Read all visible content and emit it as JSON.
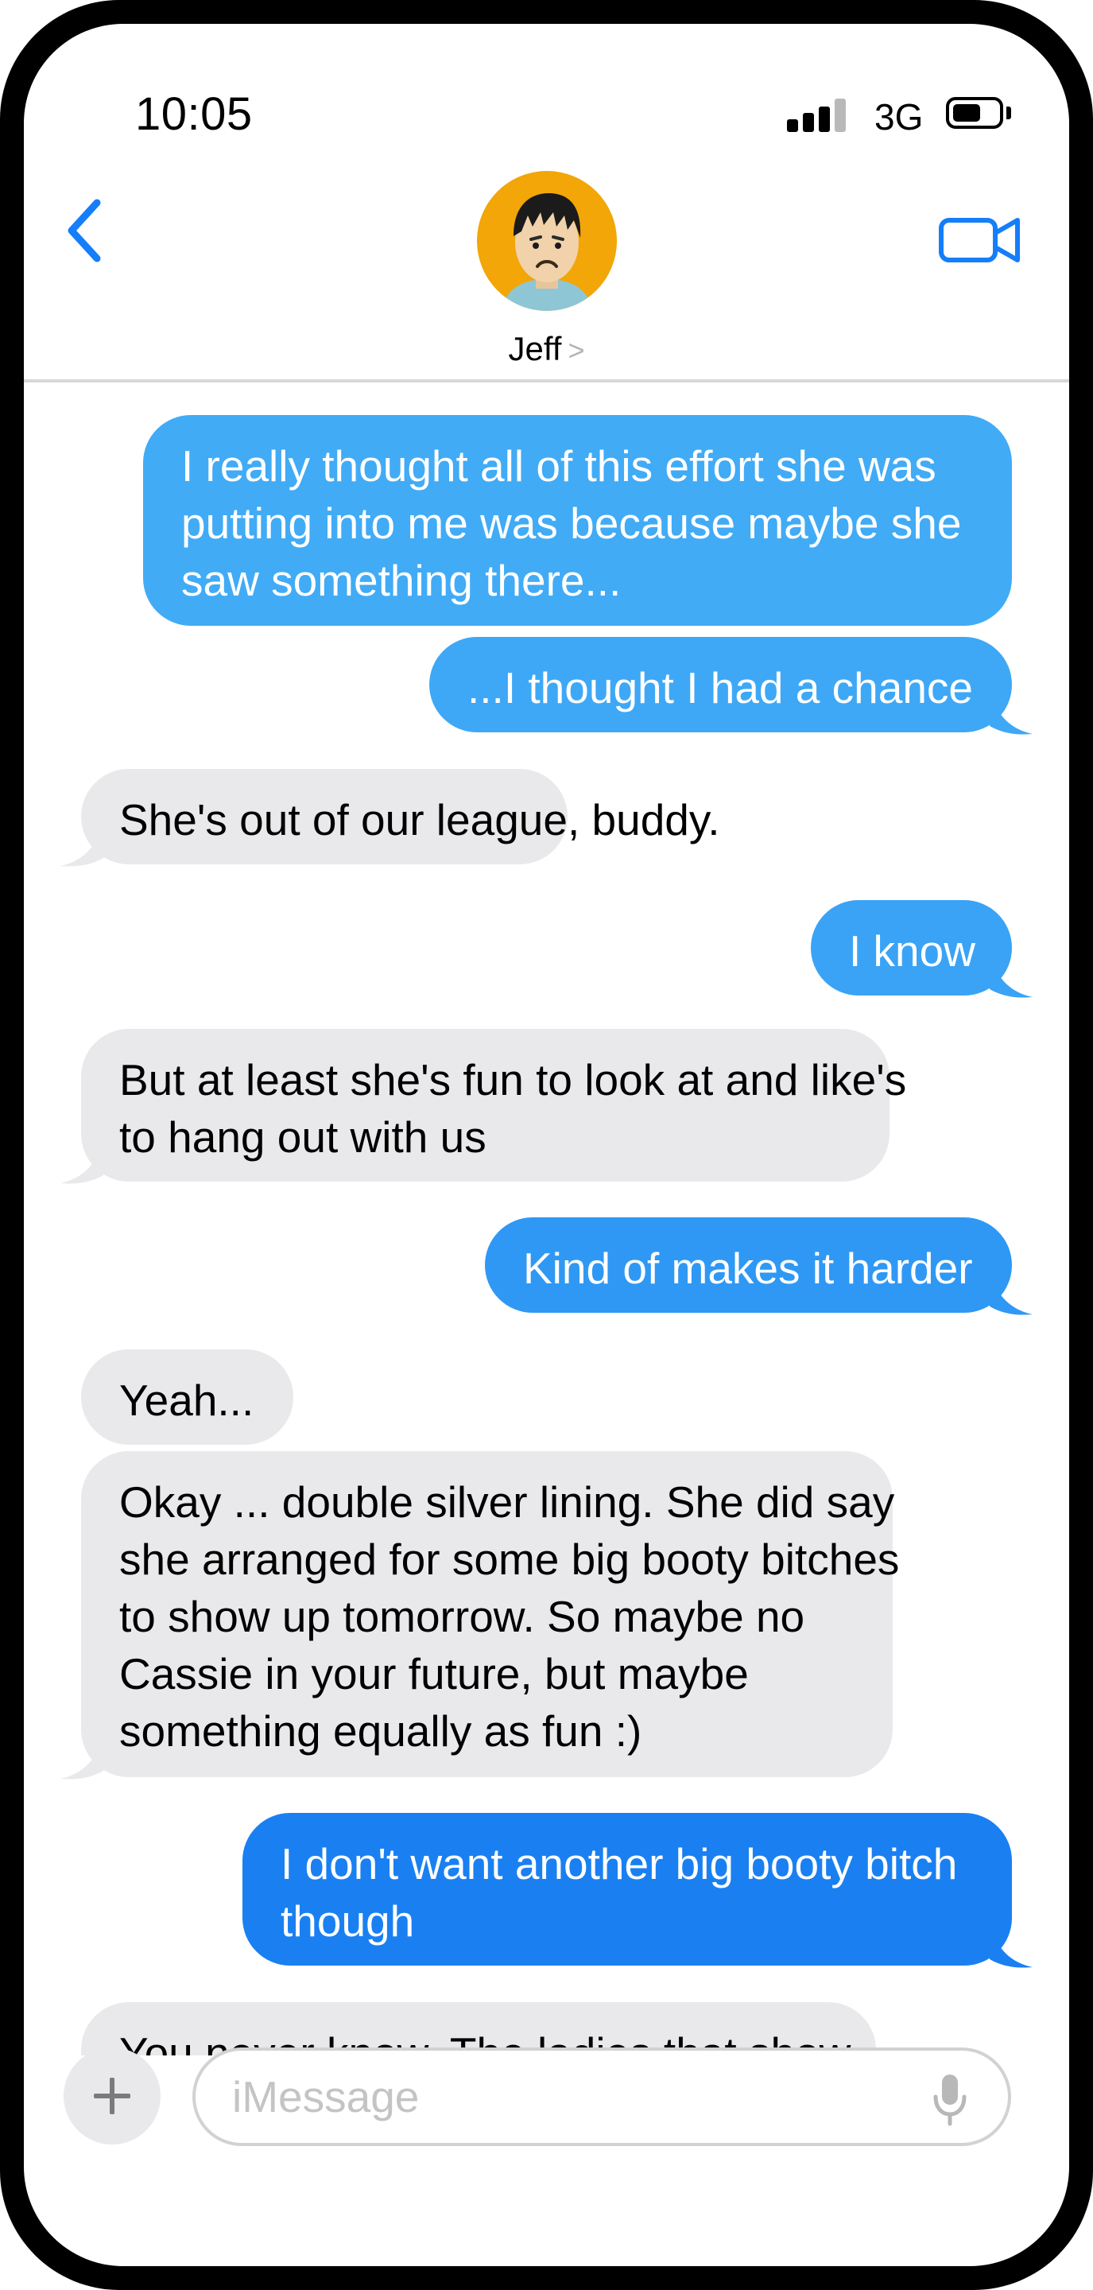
{
  "status_bar": {
    "time": "10:05",
    "network": "3G",
    "signal_icon": "cellular-signal-icon",
    "battery_icon": "battery-icon"
  },
  "header": {
    "back_icon": "chevron-left-icon",
    "contact_name": "Jeff",
    "contact_chevron": ">",
    "video_icon": "video-camera-icon",
    "avatar_icon": "sad-man-avatar"
  },
  "messages": [
    {
      "direction": "outgoing",
      "lines": [
        "I really thought all of this effort she was",
        "putting into me was because maybe she",
        "saw something there..."
      ]
    },
    {
      "direction": "outgoing",
      "lines": [
        "...I thought I had a chance"
      ]
    },
    {
      "direction": "incoming",
      "lines": [
        "She's out of our league, buddy."
      ]
    },
    {
      "direction": "outgoing",
      "lines": [
        "I know"
      ]
    },
    {
      "direction": "incoming",
      "lines": [
        "But at least she's fun to look at and like's",
        "to hang out with us"
      ]
    },
    {
      "direction": "outgoing",
      "lines": [
        "Kind of makes it harder"
      ]
    },
    {
      "direction": "incoming",
      "lines": [
        "Yeah..."
      ]
    },
    {
      "direction": "incoming",
      "lines": [
        "Okay ... double silver lining.  She did say",
        "she arranged for some big booty bitches",
        "to show up tomorrow.  So maybe no",
        "Cassie in your future, but maybe",
        "something equally as fun :)"
      ]
    },
    {
      "direction": "outgoing",
      "lines": [
        "I don't want another big booty bitch",
        "though"
      ]
    },
    {
      "direction": "incoming",
      "lines": [
        "You never know.  The ladies that show"
      ]
    }
  ],
  "composer": {
    "placeholder": "iMessage",
    "value": "",
    "plus_icon": "plus-icon",
    "mic_icon": "microphone-icon"
  },
  "colors": {
    "outgoing_light": "#40aaf5",
    "outgoing_dark": "#1a7ff2",
    "incoming": "#e9e9eb",
    "ios_blue": "#147efb"
  }
}
